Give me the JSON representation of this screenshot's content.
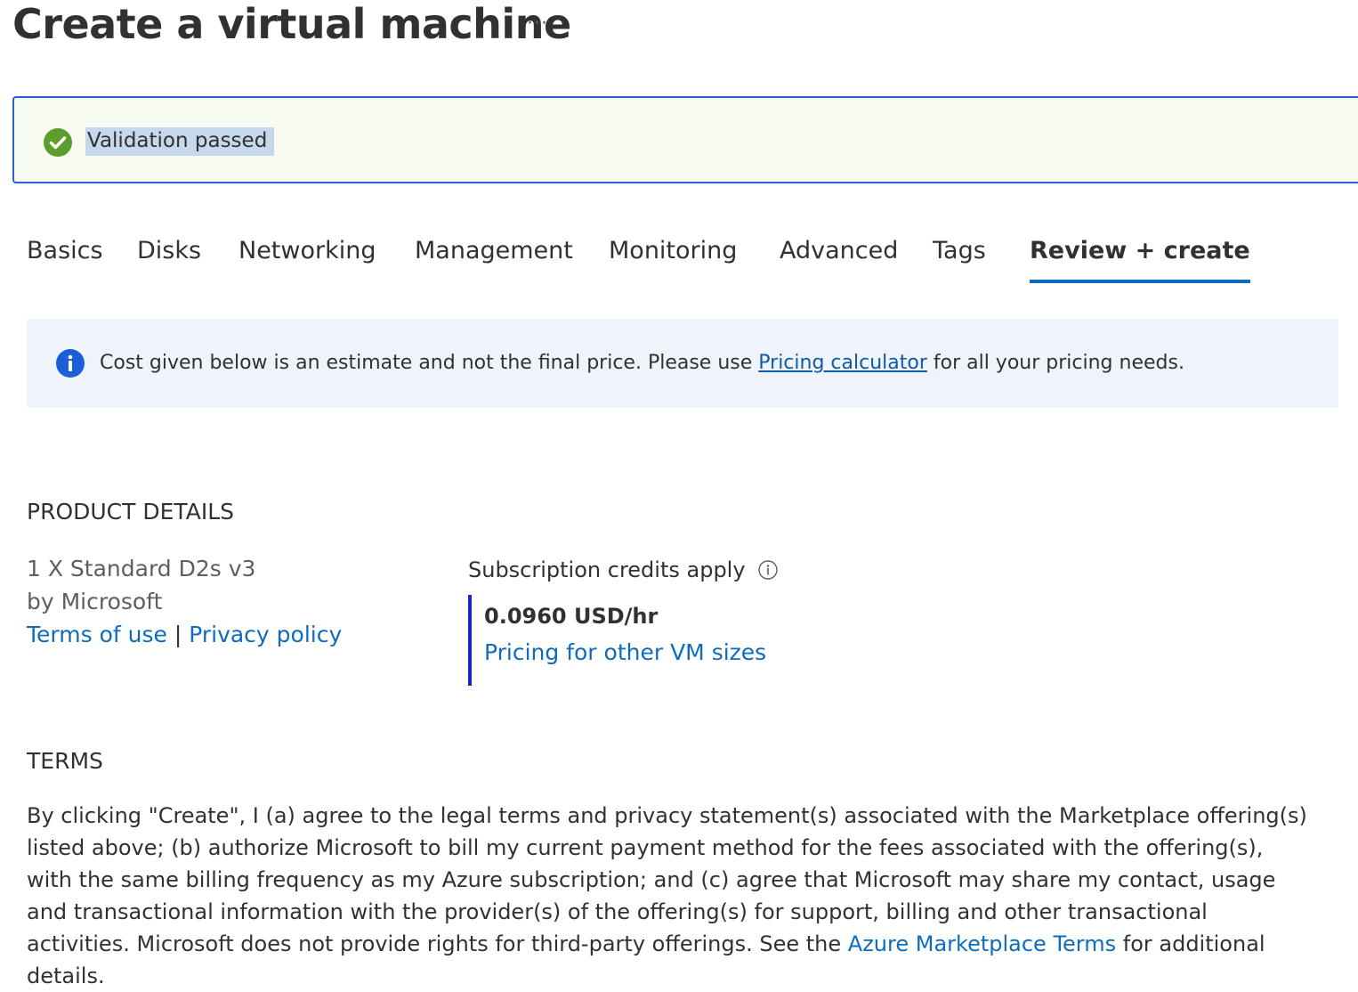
{
  "header": {
    "title": "Create a virtual machine",
    "more": "···"
  },
  "validation": {
    "text": "Validation passed",
    "status_color": "#5b9e2e"
  },
  "tabs": [
    {
      "label": "Basics"
    },
    {
      "label": "Disks"
    },
    {
      "label": "Networking"
    },
    {
      "label": "Management"
    },
    {
      "label": "Monitoring"
    },
    {
      "label": "Advanced"
    },
    {
      "label": "Tags"
    },
    {
      "label": "Review + create",
      "active": true
    }
  ],
  "info_banner": {
    "before": "Cost given below is an estimate and not the final price. Please use ",
    "link": "Pricing calculator",
    "after": " for all your pricing needs."
  },
  "product_details": {
    "heading": "PRODUCT DETAILS",
    "name": "1 X Standard D2s v3",
    "publisher": "by Microsoft",
    "terms_link": "Terms of use",
    "separator": " | ",
    "privacy_link": "Privacy policy",
    "credits": "Subscription credits apply",
    "price": "0.0960 USD/hr",
    "other_sizes_link": "Pricing for other VM sizes"
  },
  "terms": {
    "heading": "TERMS",
    "body": "By clicking \"Create\", I (a) agree to the legal terms and privacy statement(s) associated with the Marketplace offering(s) listed above; (b) authorize Microsoft to bill my current payment method for the fees associated with the offering(s), with the same billing frequency as my Azure subscription; and (c) agree that Microsoft may share my contact, usage and transactional information with the provider(s) of the offering(s) for support, billing and other transactional activities. Microsoft does not provide rights for third-party offerings. See the ",
    "link": "Azure Marketplace Terms",
    "after": " for additional details."
  },
  "colors": {
    "accent": "#0f6cbd",
    "info_icon": "#1a5fd6",
    "price_bar": "#1e23c9"
  }
}
